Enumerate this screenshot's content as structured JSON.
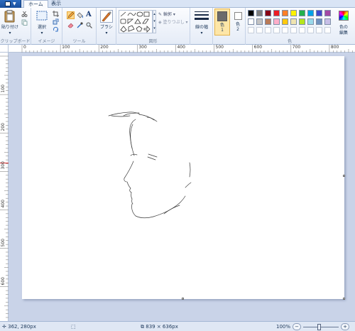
{
  "tabs": {
    "home": "ホーム",
    "view": "表示"
  },
  "clipboard": {
    "paste": "貼り付け",
    "group": "クリップボード"
  },
  "image": {
    "select": "選択",
    "group": "イメージ"
  },
  "tools": {
    "text_icon": "A",
    "group": "ツール"
  },
  "brushes": {
    "label": "ブラシ"
  },
  "shapes": {
    "outline": "輪郭",
    "fill": "塗りつぶし",
    "group": "図形"
  },
  "size": {
    "label": "線の幅"
  },
  "color1": {
    "label": "色\n1",
    "line1": "色",
    "line2": "1"
  },
  "color2": {
    "line1": "色",
    "line2": "2"
  },
  "colors": {
    "group": "色",
    "edit_line1": "色の",
    "edit_line2": "編集",
    "color1": "#6b6b6b",
    "color2": "#ffffff",
    "row1": [
      "#000000",
      "#7f7f7f",
      "#880015",
      "#ed1c24",
      "#ff7f27",
      "#fff200",
      "#22b14c",
      "#00a2e8",
      "#3f48cc",
      "#a349a4"
    ],
    "row2": [
      "#ffffff",
      "#c3c3c3",
      "#b97a57",
      "#ffaec9",
      "#ffc90e",
      "#efe4b0",
      "#b5e61d",
      "#99d9ea",
      "#7092be",
      "#c8bfe7"
    ]
  },
  "ruler_h": [
    "0",
    "100",
    "200",
    "300",
    "400",
    "500",
    "600",
    "700",
    "800"
  ],
  "ruler_v": [
    "100",
    "200",
    "300",
    "400",
    "500",
    "600"
  ],
  "status": {
    "cursor": "362, 280px",
    "size": "839 × 636px",
    "zoom": "100%"
  }
}
